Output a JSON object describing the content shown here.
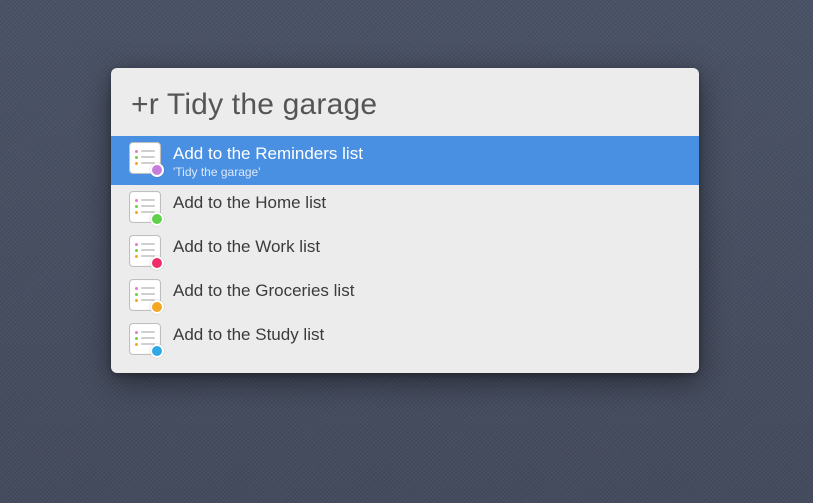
{
  "query": "+r Tidy the garage",
  "results": [
    {
      "label": "Add to the Reminders list",
      "subtitle": "'Tidy the garage'",
      "selected": true,
      "icon": {
        "dot1": "#e07fbf",
        "dot2": "#6fcf4a",
        "dot3": "#f5a623",
        "badge": "#c77ddb"
      }
    },
    {
      "label": "Add to the Home list",
      "subtitle": "",
      "selected": false,
      "icon": {
        "dot1": "#e07fbf",
        "dot2": "#6fcf4a",
        "dot3": "#f5a623",
        "badge": "#5fd24c"
      }
    },
    {
      "label": "Add to the Work list",
      "subtitle": "",
      "selected": false,
      "icon": {
        "dot1": "#e07fbf",
        "dot2": "#6fcf4a",
        "dot3": "#f5a623",
        "badge": "#ef2f6a"
      }
    },
    {
      "label": "Add to the Groceries list",
      "subtitle": "",
      "selected": false,
      "icon": {
        "dot1": "#e07fbf",
        "dot2": "#6fcf4a",
        "dot3": "#f5a623",
        "badge": "#f5a623"
      }
    },
    {
      "label": "Add to the Study list",
      "subtitle": "",
      "selected": false,
      "icon": {
        "dot1": "#e07fbf",
        "dot2": "#6fcf4a",
        "dot3": "#f5a623",
        "badge": "#2fa8e6"
      }
    }
  ]
}
